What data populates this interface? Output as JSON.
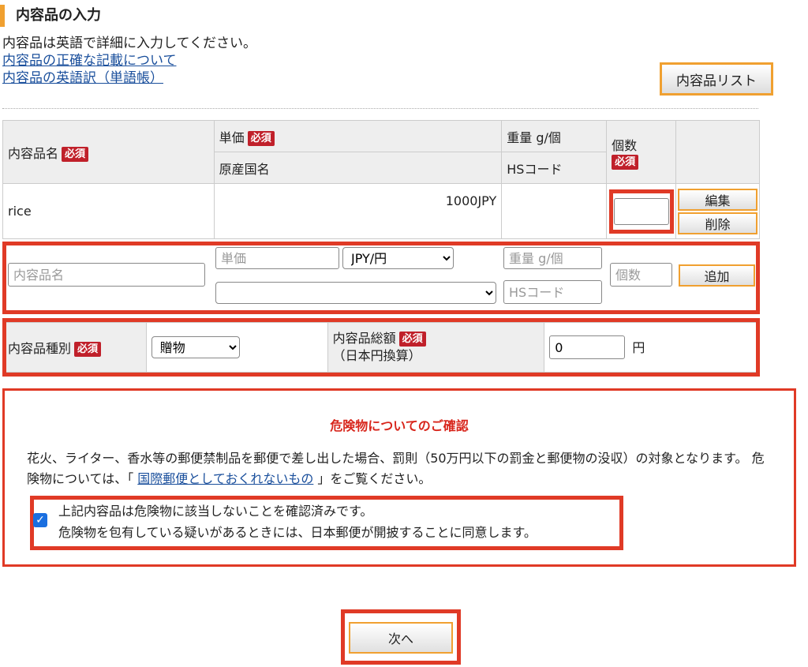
{
  "section": {
    "title": "内容品の入力"
  },
  "intro": {
    "text": "内容品は英語で詳細に入力してください。",
    "link1": "内容品の正確な記載について",
    "link2": "内容品の英語訳（単語帳）"
  },
  "list_button": "内容品リスト",
  "required": "必須",
  "table": {
    "headers": {
      "name": "内容品名",
      "price": "単価",
      "origin": "原産国名",
      "weight": "重量 g/個",
      "hs": "HSコード",
      "qty": "個数"
    },
    "row": {
      "name": "rice",
      "price": "1000JPY",
      "qty": ""
    },
    "edit_button": "編集",
    "delete_button": "削除"
  },
  "add_row": {
    "name_placeholder": "内容品名",
    "price_placeholder": "単価",
    "currency": "JPY/円",
    "weight_placeholder": "重量 g/個",
    "hs_placeholder": "HSコード",
    "origin": "",
    "qty_placeholder": "個数",
    "add_button": "追加"
  },
  "kind": {
    "label": "内容品種別",
    "value": "贈物",
    "total_label": "内容品総額",
    "total_sub": "（日本円換算）",
    "total_value": "0",
    "unit": "円"
  },
  "danger": {
    "title": "危険物についてのご確認",
    "text1": "花火、ライター、香水等の郵便禁制品を郵便で差し出した場合、罰則（50万円以下の罰金と郵便物の没収）の対象となります。 危険物については、「 ",
    "link": "国際郵便としておくれないもの",
    "text2": " 」をご覧ください。",
    "check_line1": "上記内容品は危険物に該当しないことを確認済みです。",
    "check_line2": "危険物を包有している疑いがあるときには、日本郵便が開披することに同意します。",
    "checked": true
  },
  "next_button": "次へ"
}
